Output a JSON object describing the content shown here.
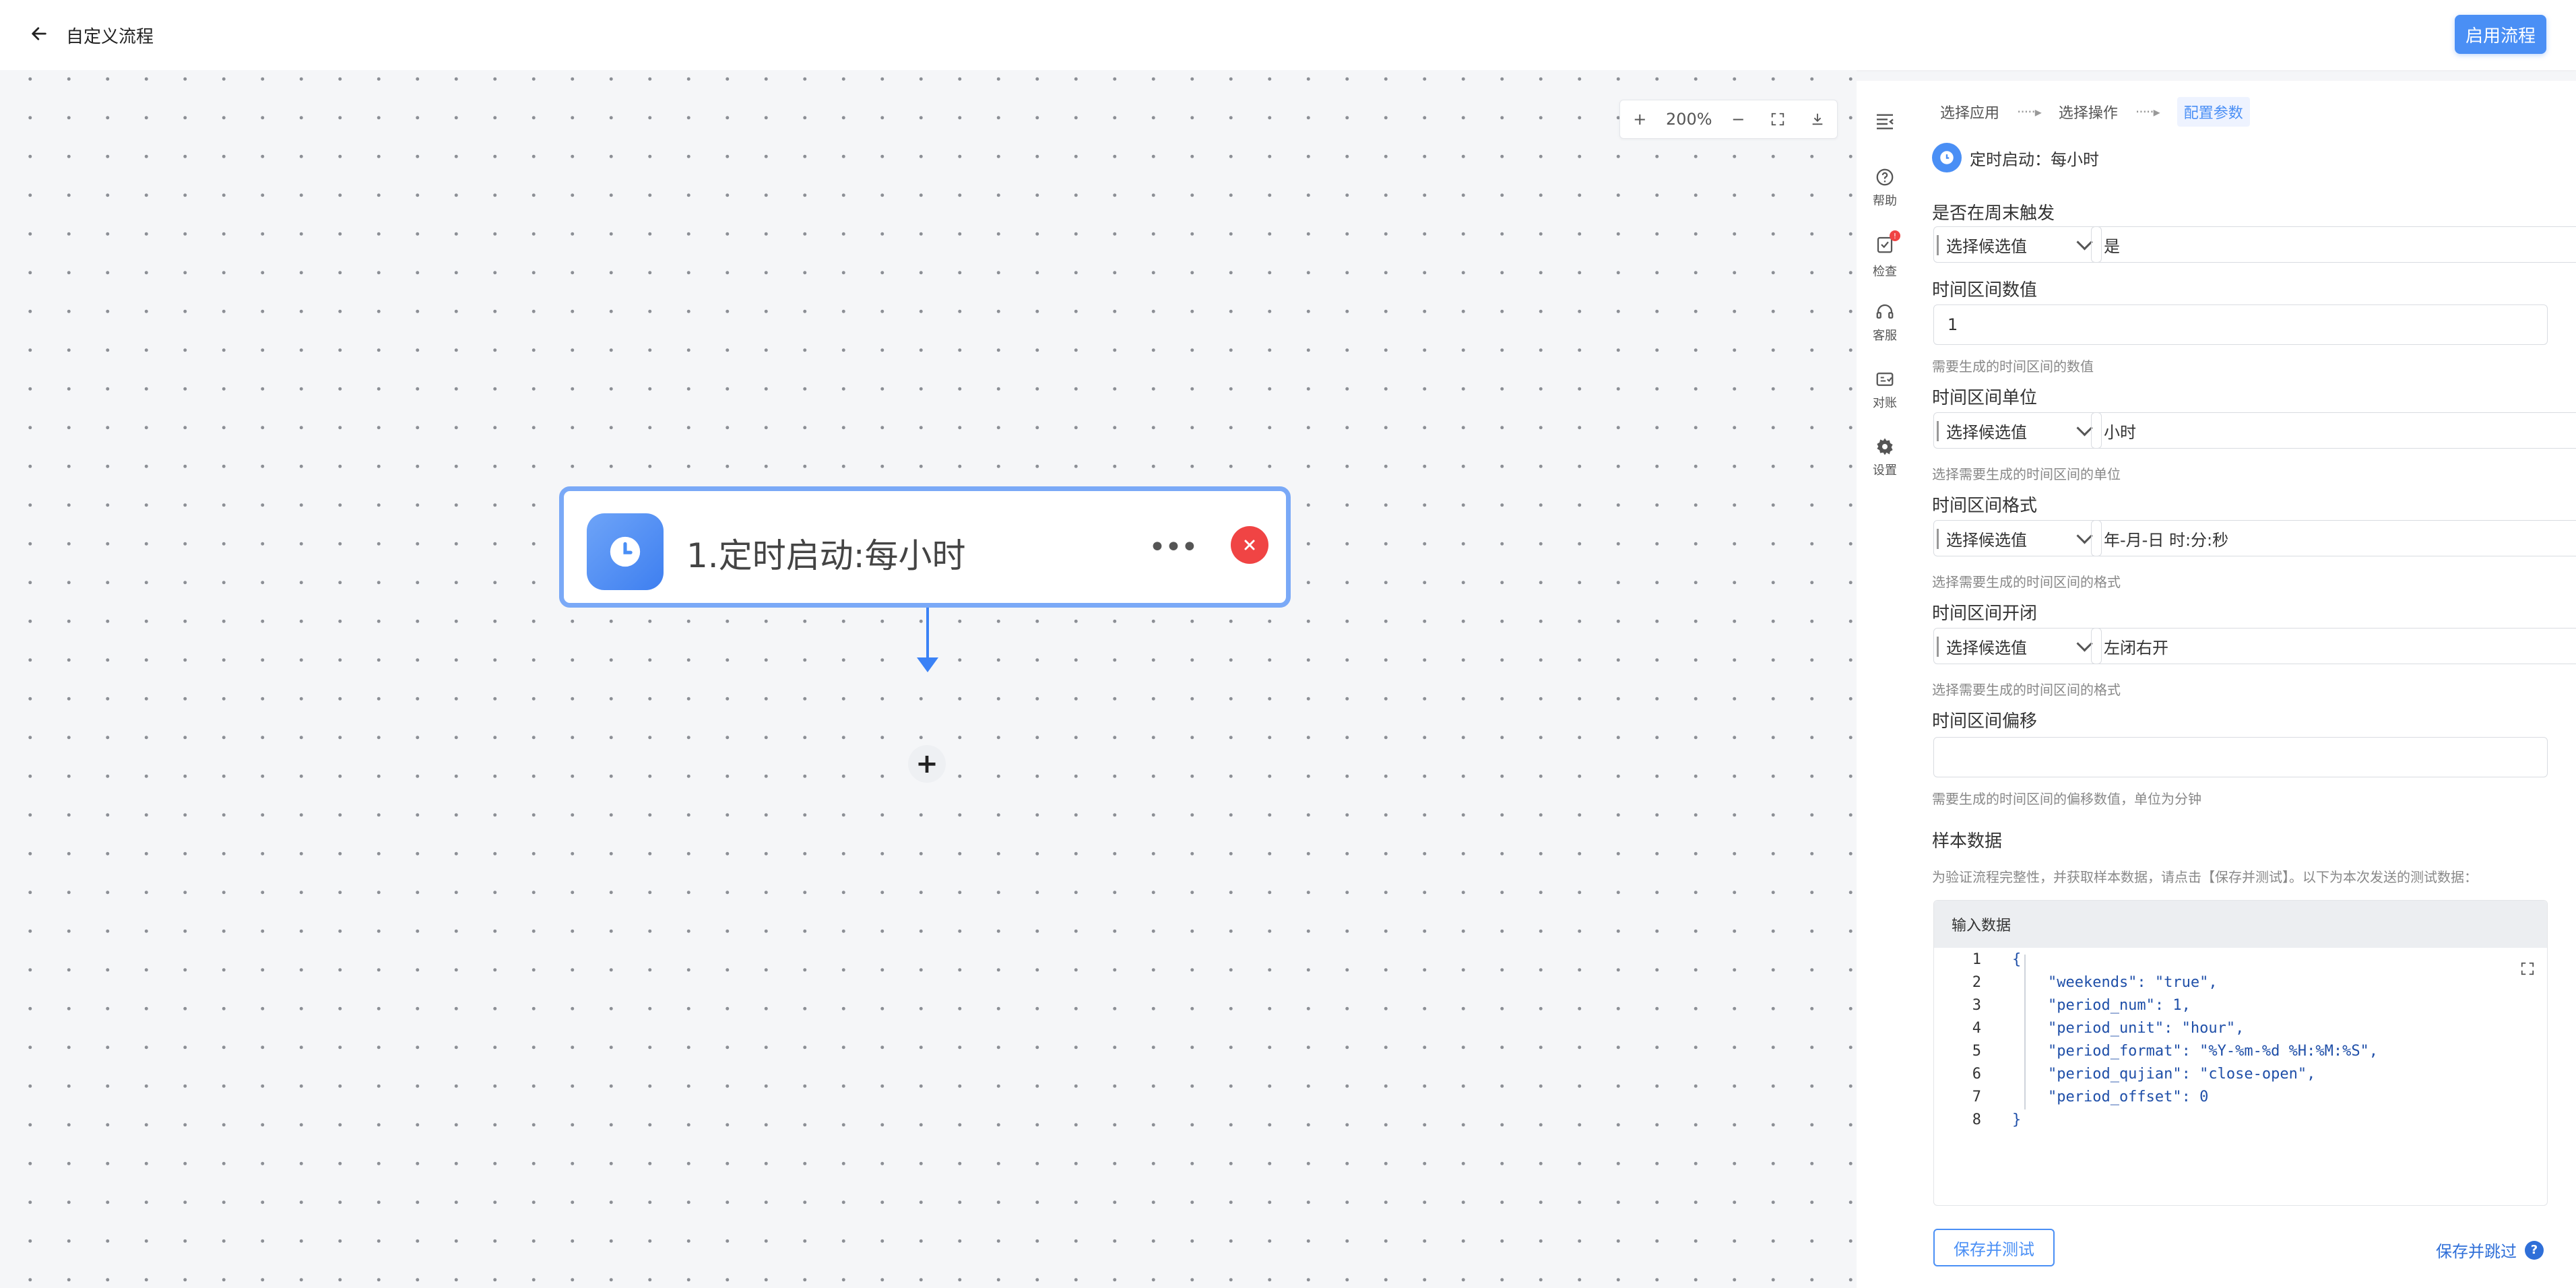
{
  "header": {
    "back_icon": "arrow-left-icon",
    "title": "自定义流程",
    "enable_button": "启用流程",
    "accent": "#4a8ff5"
  },
  "canvas": {
    "zoom": {
      "zoom_in": "+",
      "level": "200%",
      "zoom_out": "−",
      "fullscreen_icon": "fullscreen-icon",
      "download_icon": "download-icon"
    },
    "node": {
      "icon": "clock-icon",
      "title": "1.定时启动:每小时",
      "more": "•••",
      "close_icon": "close-icon"
    },
    "add_node": "+"
  },
  "tools": [
    {
      "icon": "collapse-icon",
      "label": ""
    },
    {
      "icon": "help-icon",
      "label": "帮助"
    },
    {
      "icon": "check-icon",
      "label": "检查",
      "badge": "!"
    },
    {
      "icon": "headset-icon",
      "label": "客服"
    },
    {
      "icon": "reconcile-icon",
      "label": "对账"
    },
    {
      "icon": "gear-icon",
      "label": "设置"
    }
  ],
  "panel": {
    "steps": [
      "选择应用",
      "选择操作",
      "配置参数"
    ],
    "step_sep": "·····▸",
    "trigger": {
      "icon": "clock-icon",
      "text": "定时启动：每小时"
    },
    "fields": {
      "weekend": {
        "label": "是否在周末触发",
        "mode": "选择候选值",
        "value": "是"
      },
      "interval_num": {
        "label": "时间区间数值",
        "value": "1",
        "hint": "需要生成的时间区间的数值"
      },
      "interval_unit": {
        "label": "时间区间单位",
        "mode": "选择候选值",
        "value": "小时",
        "hint": "选择需要生成的时间区间的单位"
      },
      "interval_format": {
        "label": "时间区间格式",
        "mode": "选择候选值",
        "value": "年-月-日 时:分:秒",
        "hint": "选择需要生成的时间区间的格式"
      },
      "interval_open": {
        "label": "时间区间开闭",
        "mode": "选择候选值",
        "value": "左闭右开",
        "hint": "选择需要生成的时间区间的格式"
      },
      "interval_offset": {
        "label": "时间区间偏移",
        "value": "",
        "hint": "需要生成的时间区间的偏移数值，单位为分钟"
      }
    },
    "sample": {
      "label": "样本数据",
      "hint": "为验证流程完整性，并获取样本数据，请点击【保存并测试】。以下为本次发送的测试数据：",
      "input_title": "输入数据",
      "expand_icon": "expand-icon",
      "lines": [
        {
          "n": "1",
          "t": "{"
        },
        {
          "n": "2",
          "t": "    \"weekends\": \"true\","
        },
        {
          "n": "3",
          "t": "    \"period_num\": 1,"
        },
        {
          "n": "4",
          "t": "    \"period_unit\": \"hour\","
        },
        {
          "n": "5",
          "t": "    \"period_format\": \"%Y-%m-%d %H:%M:%S\","
        },
        {
          "n": "6",
          "t": "    \"period_qujian\": \"close-open\","
        },
        {
          "n": "7",
          "t": "    \"period_offset\": 0"
        },
        {
          "n": "8",
          "t": "}"
        }
      ]
    },
    "save_test": "保存并测试",
    "save_skip": "保存并跳过",
    "help_glyph": "?"
  }
}
